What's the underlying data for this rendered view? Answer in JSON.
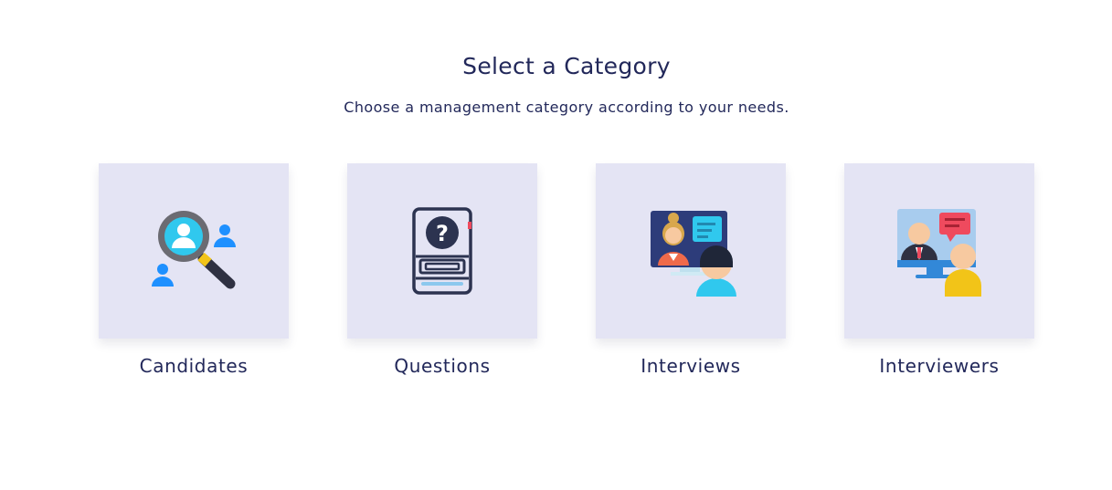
{
  "page": {
    "title": "Select a Category",
    "subtitle": "Choose a management category according to your needs."
  },
  "categories": [
    {
      "label": "Candidates",
      "icon": "magnifier-people-icon"
    },
    {
      "label": "Questions",
      "icon": "question-book-icon"
    },
    {
      "label": "Interviews",
      "icon": "video-interview-icon"
    },
    {
      "label": "Interviewers",
      "icon": "interviewer-chat-icon"
    }
  ],
  "colors": {
    "text": "#22285a",
    "tile_background": "#e4e4f4",
    "accent_blue": "#1e90ff",
    "accent_cyan": "#30c8ee",
    "accent_yellow": "#f2c418",
    "accent_red": "#ef4a5e"
  }
}
